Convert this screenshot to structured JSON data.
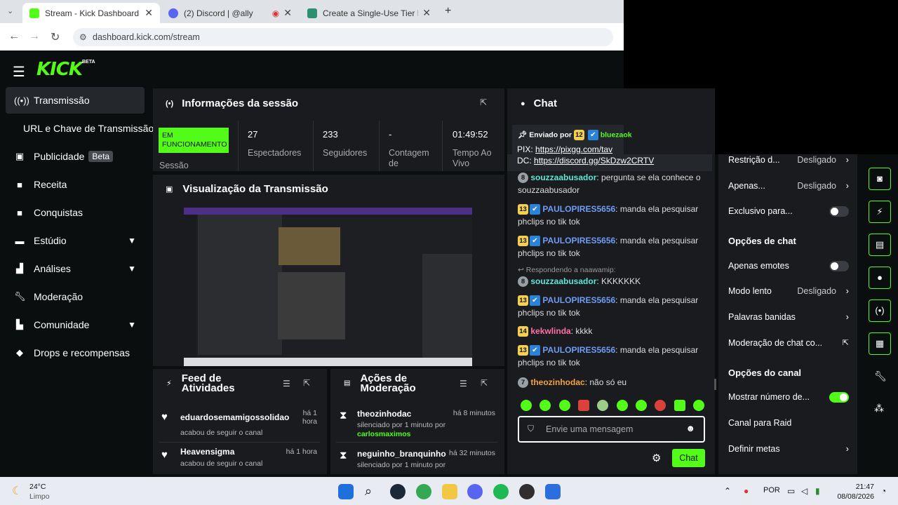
{
  "browser": {
    "tabs": [
      {
        "title": "Stream - Kick Dashboard",
        "active": true
      },
      {
        "title": "(2) Discord | @ally",
        "active": false
      },
      {
        "title": "Create a Single-Use Tier List (Pri",
        "active": false
      }
    ],
    "new_tab": "+",
    "url": "dashboard.kick.com/stream"
  },
  "brand": {
    "logo": "KICK",
    "beta": "BETA",
    "accent": "#53fc18"
  },
  "sidebar": {
    "items": [
      {
        "label": "Transmissão",
        "icon": "broadcast-icon",
        "active": true
      },
      {
        "label": "URL e Chave de Transmissão",
        "icon": "",
        "active": false
      },
      {
        "label": "Publicidade",
        "icon": "ad-icon",
        "badge": "Beta"
      },
      {
        "label": "Receita",
        "icon": "revenue-icon"
      },
      {
        "label": "Conquistas",
        "icon": "achievements-icon"
      },
      {
        "label": "Estúdio",
        "icon": "studio-icon",
        "expand": true
      },
      {
        "label": "Análises",
        "icon": "analytics-icon",
        "expand": true
      },
      {
        "label": "Moderação",
        "icon": "wrench-icon"
      },
      {
        "label": "Comunidade",
        "icon": "community-icon",
        "expand": true
      },
      {
        "label": "Drops e recompensas",
        "icon": "drops-icon"
      }
    ]
  },
  "session": {
    "title": "Informações da sessão",
    "status": "EM FUNCIONAMENTO",
    "status_label": "Sessão",
    "stats": [
      {
        "value": "27",
        "label": "Espectadores"
      },
      {
        "value": "233",
        "label": "Seguidores"
      },
      {
        "value": "-",
        "label": "Contagem de"
      },
      {
        "value": "01:49:52",
        "label": "Tempo Ao Vivo"
      }
    ]
  },
  "preview": {
    "title": "Visualização da Transmissão"
  },
  "feed": {
    "title": "Feed de Atividades",
    "items": [
      {
        "user": "eduardosemamigossolidao",
        "action": "acabou de seguir o canal",
        "time": "há 1 hora"
      },
      {
        "user": "Heavensigma",
        "action": "acabou de seguir o canal",
        "time": "há 1 hora"
      }
    ]
  },
  "mod_actions": {
    "title": "Ações de Moderação",
    "items": [
      {
        "user": "theozinhodac",
        "action": "silenciado por 1 minuto por",
        "by": "carlosmaximos",
        "time": "há 8 minutos"
      },
      {
        "user": "neguinho_branquinho",
        "action": "silenciado por 1 minuto por",
        "by": "",
        "time": "há 32 minutos"
      }
    ]
  },
  "chat": {
    "title": "Chat",
    "pinned": {
      "label": "Enviado por",
      "badge": "12",
      "user": "bluezaok",
      "line1_prefix": "PIX:",
      "line1_link": "https://pixgg.com/tav",
      "line2_prefix": "DC:",
      "line2_link": "https://discord.gg/SkDzw2CRTV"
    },
    "messages": [
      {
        "badge": "8",
        "badge_type": "gray",
        "user": "souzzaabusador",
        "color": "cyan",
        "text": "pergunta se ela conhece o souzzaabusador"
      },
      {
        "badge": "13",
        "badge_type": "gold",
        "blue": true,
        "user": "PAULOPIRES5656",
        "color": "blue",
        "text": "manda ela pesquisar phclips no tik tok"
      },
      {
        "badge": "13",
        "badge_type": "gold",
        "blue": true,
        "user": "PAULOPIRES5656",
        "color": "blue",
        "text": "manda ela pesquisar phclips no tik tok"
      },
      {
        "reply": "Respondendo a naawamip:"
      },
      {
        "badge": "8",
        "badge_type": "gray",
        "user": "souzzaabusador",
        "color": "cyan",
        "text": "KKKKKKK"
      },
      {
        "badge": "13",
        "badge_type": "gold",
        "blue": true,
        "user": "PAULOPIRES5656",
        "color": "blue",
        "text": "manda ela pesquisar phclips no tik tok"
      },
      {
        "badge": "14",
        "badge_type": "gold",
        "user": "kekwlinda",
        "color": "pink",
        "text": "kkkk"
      },
      {
        "badge": "13",
        "badge_type": "gold",
        "blue": true,
        "user": "PAULOPIRES5656",
        "color": "blue",
        "text": "manda ela pesquisar phclips no tik tok"
      },
      {
        "badge": "7",
        "badge_type": "gray",
        "user": "theozinhodac",
        "color": "orange",
        "text": "não só eu"
      }
    ],
    "input_placeholder": "Envie uma mensagem",
    "send_label": "Chat"
  },
  "settings": {
    "rows_top": [
      {
        "label": "Restrição d...",
        "value": "Desligado",
        "arrow": true
      },
      {
        "label": "Apenas...",
        "value": "Desligado",
        "arrow": true
      },
      {
        "label": "Exclusivo para...",
        "toggle": false
      }
    ],
    "chat_options_title": "Opções de chat",
    "chat_options": [
      {
        "label": "Apenas emotes",
        "toggle": false
      },
      {
        "label": "Modo lento",
        "value": "Desligado",
        "arrow": true
      },
      {
        "label": "Palavras banidas",
        "arrow": true
      },
      {
        "label": "Moderação de chat co...",
        "external": true
      }
    ],
    "channel_options_title": "Opções do canal",
    "channel_options": [
      {
        "label": "Mostrar número de...",
        "toggle": true
      },
      {
        "label": "Canal para Raid"
      },
      {
        "label": "Definir metas",
        "arrow": true
      }
    ]
  },
  "taskbar": {
    "weather_temp": "24°C",
    "weather_desc": "Limpo",
    "lang": "POR",
    "time": "21:47",
    "date": "08/08/2026"
  }
}
